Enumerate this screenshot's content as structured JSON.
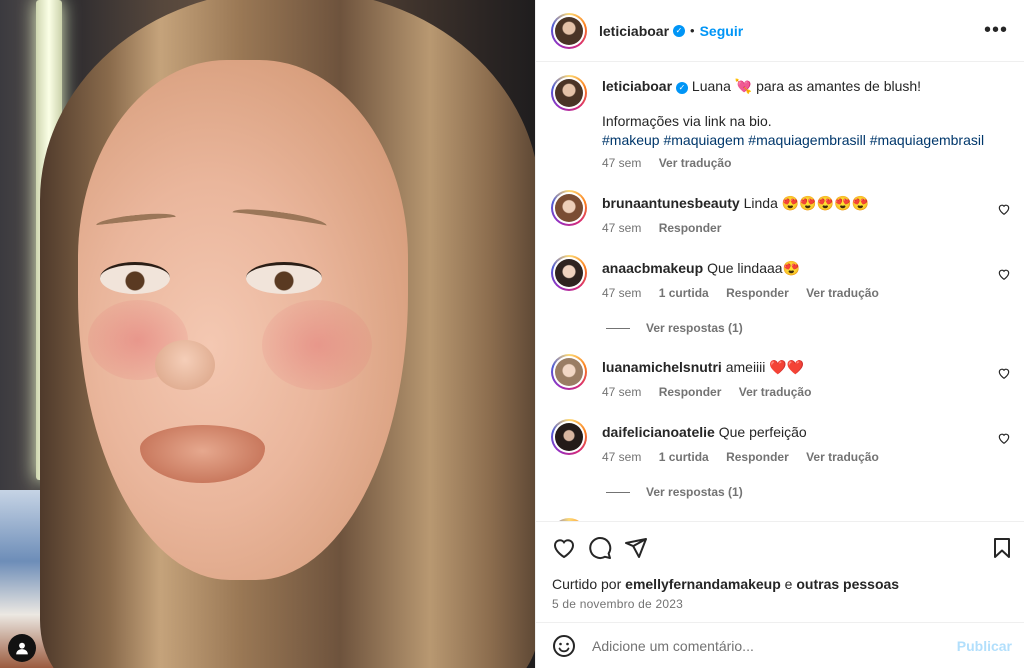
{
  "post": {
    "author": "leticiaboar",
    "follow_label": "Seguir",
    "dot": "•",
    "more_label": "•••",
    "caption_text": "Luana 💘  para as amantes de blush!",
    "caption_line2": "Informações via link na bio.",
    "hashtags": "#makeup #maquiagem #maquiagembrasill #maquiagembrasil",
    "caption_time": "47 sem",
    "caption_translate": "Ver tradução"
  },
  "comments": [
    {
      "user": "brunaantunesbeauty",
      "text": "Linda 😍😍😍😍😍",
      "time": "47 sem",
      "reply": "Responder"
    },
    {
      "user": "anaacbmakeup",
      "text": "Que lindaaa😍",
      "time": "47 sem",
      "likes": "1 curtida",
      "reply": "Responder",
      "translate": "Ver tradução",
      "replies": "Ver respostas (1)"
    },
    {
      "user": "luanamichelsnutri",
      "text": "ameiiii ❤️❤️",
      "time": "47 sem",
      "reply": "Responder",
      "translate": "Ver tradução"
    },
    {
      "user": "daifelicianoatelie",
      "text": "Que perfeição",
      "time": "47 sem",
      "likes": "1 curtida",
      "reply": "Responder",
      "translate": "Ver tradução",
      "replies": "Ver respostas (1)"
    }
  ],
  "footer": {
    "liked_prefix": "Curtido por",
    "liked_user": "emellyfernandamakeup",
    "liked_and": "e",
    "liked_others": "outras pessoas",
    "date": "5 de novembro de 2023",
    "comment_placeholder": "Adicione um comentário...",
    "publish_label": "Publicar",
    "emoji_icon": "smiley-icon"
  },
  "colors": {
    "accent": "#0095f6",
    "link": "#00376b",
    "muted": "#737373",
    "publish_disabled": "#b2dffc"
  }
}
